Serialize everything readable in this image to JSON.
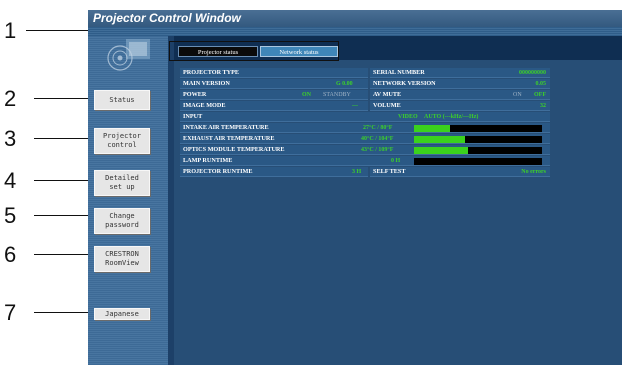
{
  "window_title": "Projector Control Window",
  "callouts": [
    "1",
    "2",
    "3",
    "4",
    "5",
    "6",
    "7"
  ],
  "tabs": [
    {
      "label": "Projector status",
      "active": true
    },
    {
      "label": "Network status",
      "active": false
    }
  ],
  "sidebar": {
    "status": "Status",
    "projector_control": [
      "Projector",
      "control"
    ],
    "detailed_setup": [
      "Detailed",
      "set up"
    ],
    "change_password": [
      "Change",
      "password"
    ],
    "crestron": [
      "CRESTRON",
      "RoomView"
    ],
    "japanese": "Japanese"
  },
  "status": {
    "projector_type_label": "PROJECTOR TYPE",
    "serial_number_label": "SERIAL NUMBER",
    "serial_number": "000000000",
    "main_version_label": "MAIN VERSION",
    "main_version": "G 0.00",
    "network_version_label": "NETWORK VERSION",
    "network_version": "0.05",
    "power_label": "POWER",
    "power_on": "ON",
    "power_standby": "STANDBY",
    "av_mute_label": "AV MUTE",
    "av_mute_on": "ON",
    "av_mute_off": "OFF",
    "image_mode_label": "IMAGE MODE",
    "image_mode": "---",
    "volume_label": "VOLUME",
    "volume": "32",
    "input_label": "INPUT",
    "input": "VIDEO",
    "input_freq": "AUTO (---kHz/---Hz)",
    "intake_label": "INTAKE AIR TEMPERATURE",
    "intake": "27°C / 80°F",
    "intake_level": 0.28,
    "exhaust_label": "EXHAUST AIR TEMPERATURE",
    "exhaust": "40°C / 104°F",
    "exhaust_level": 0.4,
    "optics_label": "OPTICS MODULE TEMPERATURE",
    "optics": "43°C / 109°F",
    "optics_level": 0.42,
    "lamp_label": "LAMP RUNTIME",
    "lamp": "0 H",
    "lamp_level": 0.0,
    "projector_runtime_label": "PROJECTOR RUNTIME",
    "projector_runtime": "3 H",
    "self_test_label": "SELF TEST",
    "self_test": "No errors"
  },
  "colors": {
    "window_bg": "#274e76",
    "value_green": "#3ccf2a",
    "bar_fill": "#3bd11d",
    "cell_bg": "#2a5885"
  }
}
